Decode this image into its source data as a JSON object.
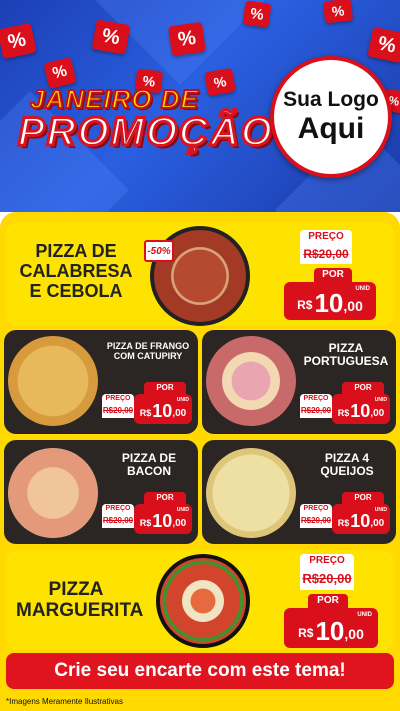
{
  "header": {
    "tags": [
      "%",
      "%",
      "%",
      "%",
      "%",
      "%",
      "%",
      "%",
      "%",
      "%"
    ],
    "title_line1": "JANEIRO DE",
    "title_line2": "PROMOÇÃO",
    "logo_line1": "Sua Logo",
    "logo_line2": "Aqui"
  },
  "labels": {
    "preco": "PREÇO",
    "por": "POR",
    "currency": "R$",
    "unid": "UNID"
  },
  "products": [
    {
      "name_lines": [
        "PIZZA DE",
        "CALABRESA",
        "E CEBOLA"
      ],
      "old_price": "R$20,00",
      "new_price": "10",
      "new_cents": ",00",
      "discount": "-50%"
    },
    {
      "name_lines": [
        "PIZZA DE FRANGO",
        "COM CATUPIRY"
      ],
      "old_price": "R$20,00",
      "new_price": "10",
      "new_cents": ",00"
    },
    {
      "name_lines": [
        "PIZZA",
        "PORTUGUESA"
      ],
      "old_price": "R$20,00",
      "new_price": "10",
      "new_cents": ",00"
    },
    {
      "name_lines": [
        "PIZZA DE",
        "BACON"
      ],
      "old_price": "R$20,00",
      "new_price": "10",
      "new_cents": ",00"
    },
    {
      "name_lines": [
        "PIZZA 4",
        "QUEIJOS"
      ],
      "old_price": "R$20,00",
      "new_price": "10",
      "new_cents": ",00"
    },
    {
      "name_lines": [
        "PIZZA",
        "MARGUERITA"
      ],
      "old_price": "R$20,00",
      "new_price": "10",
      "new_cents": ",00"
    }
  ],
  "footer": {
    "banner": "Crie seu encarte com este tema!",
    "disclaimer": "*Imagens Meramente Ilustrativas"
  },
  "colors": {
    "red": "#d9101b",
    "yellow": "#ffd900",
    "dark": "#2b2624",
    "blue": "#1c3fb5"
  }
}
